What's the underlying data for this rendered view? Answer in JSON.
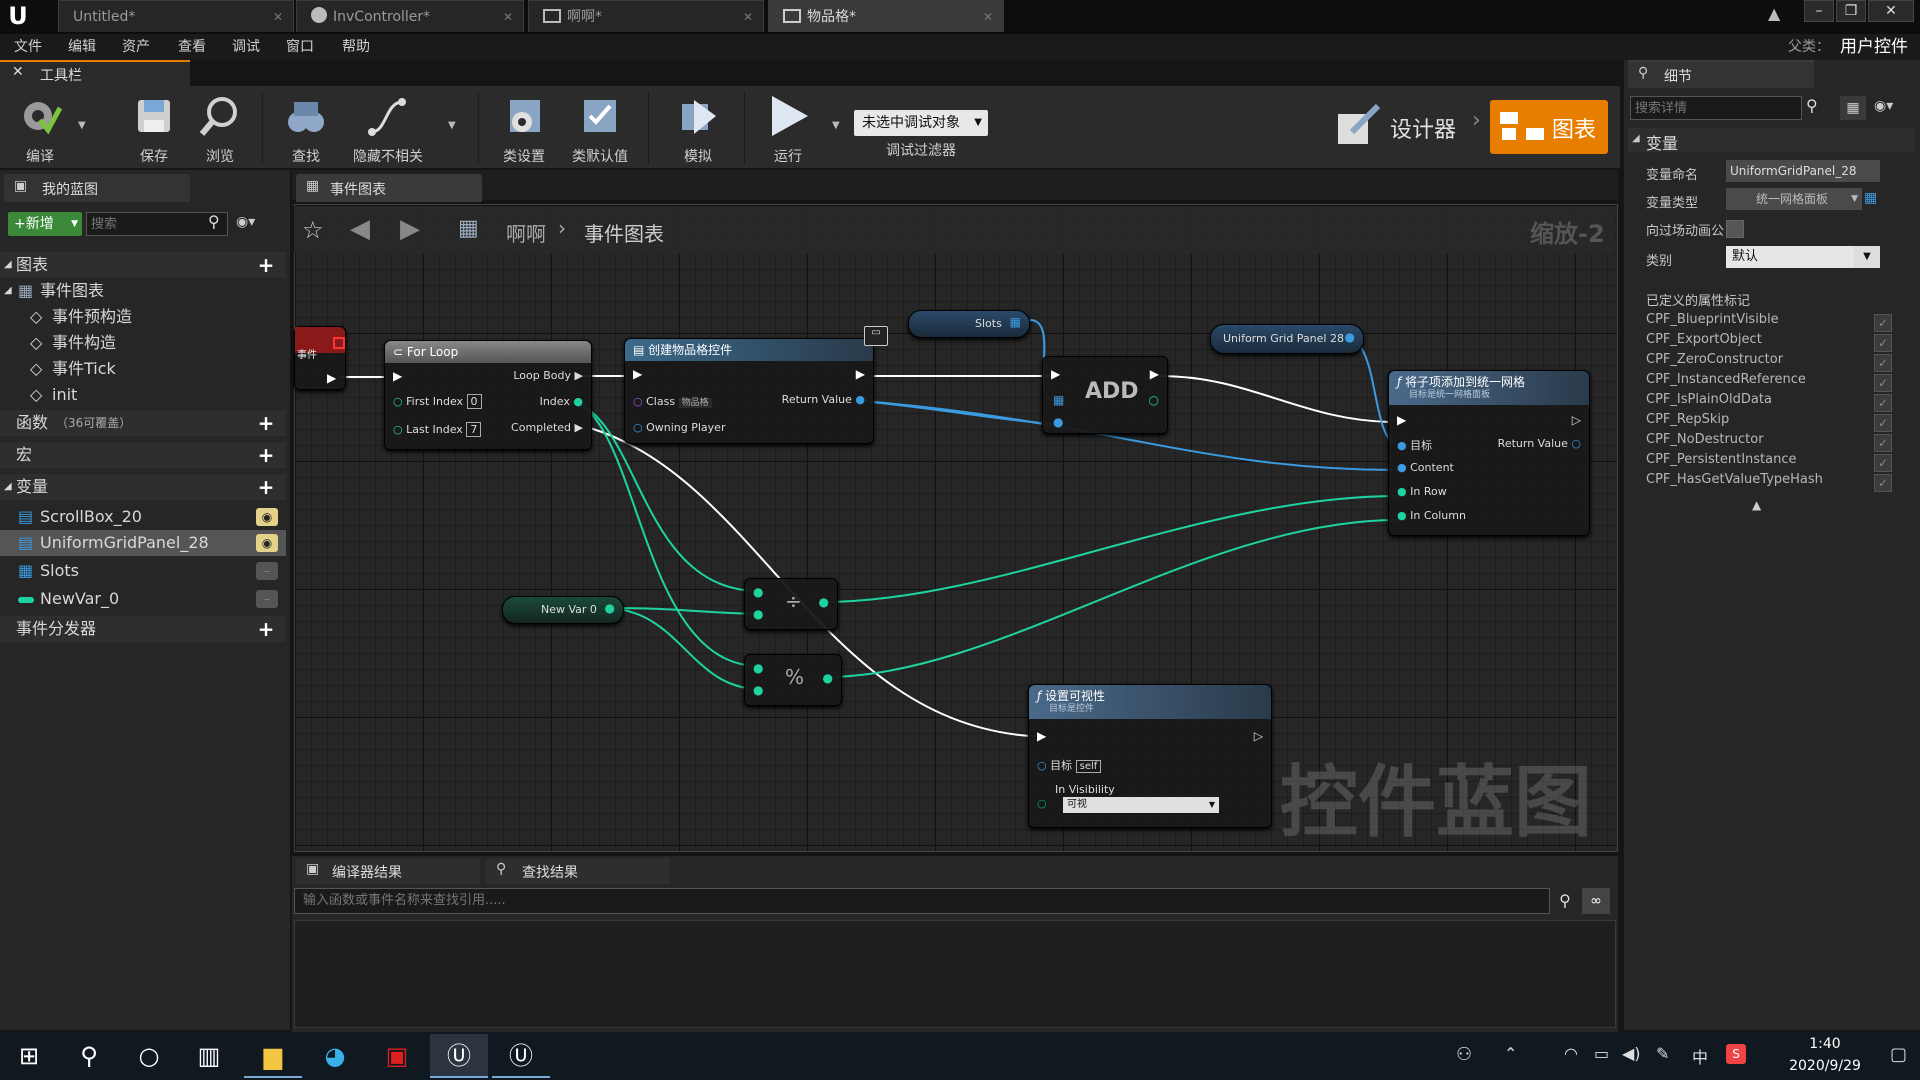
{
  "app": {
    "logo": "U",
    "brand_color": "#e87e00"
  },
  "tabs": [
    {
      "label": "Untitled*"
    },
    {
      "label": "InvController*"
    },
    {
      "label": "啊啊*"
    },
    {
      "label": "物品格*"
    }
  ],
  "parent": {
    "label": "父类：",
    "value": "用户控件"
  },
  "menu": [
    "文件",
    "编辑",
    "资产",
    "查看",
    "调试",
    "窗口",
    "帮助"
  ],
  "toolbar": {
    "tab_label": "工具栏",
    "buttons": [
      "编译",
      "保存",
      "浏览",
      "查找",
      "隐藏不相关",
      "类设置",
      "类默认值",
      "模拟",
      "运行"
    ],
    "debug_select": "未选中调试对象",
    "debug_filter": "调试过滤器",
    "designer": "设计器",
    "graph": "图表"
  },
  "my_blueprint": {
    "tab": "我的蓝图",
    "add_button": "+新增",
    "search_placeholder": "搜索",
    "sections": {
      "graphs": "图表",
      "event_graph": "事件图表",
      "events": [
        "事件预构造",
        "事件构造",
        "事件Tick",
        "init"
      ],
      "functions": "函数",
      "functions_note": "（36可覆盖）",
      "macros": "宏",
      "variables": "变量",
      "vars": [
        "ScrollBox_20",
        "UniformGridPanel_28",
        "Slots",
        "NewVar_0"
      ],
      "dispatchers": "事件分发器"
    }
  },
  "graph": {
    "tab": "事件图表",
    "breadcrumb_root": "啊啊",
    "breadcrumb_leaf": "事件图表",
    "zoom": "缩放-2",
    "watermark": "控件蓝图",
    "nodes": {
      "event_stub": "事件",
      "for_loop": {
        "title": "For Loop",
        "loop_body": "Loop Body",
        "first_index": "First Index",
        "first_index_val": "0",
        "index": "Index",
        "last_index": "Last Index",
        "last_index_val": "7",
        "completed": "Completed"
      },
      "create_widget": {
        "title": "创建物品格控件",
        "class": "Class",
        "class_val": "物品格",
        "return_value": "Return Value",
        "owning_player": "Owning Player"
      },
      "slots": "Slots",
      "add": "ADD",
      "ugp": "Uniform Grid Panel 28",
      "add_child": {
        "title": "将子项添加到统一网格",
        "subtitle": "目标是统一网格面板",
        "target": "目标",
        "return_value": "Return Value",
        "content": "Content",
        "in_row": "In Row",
        "in_column": "In Column"
      },
      "new_var": "New Var 0",
      "divide": "÷",
      "modulo": "%",
      "set_vis": {
        "title": "设置可视性",
        "subtitle": "目标是控件",
        "target": "目标",
        "self": "self",
        "in_visibility": "In Visibility",
        "vis_val": "可视"
      }
    }
  },
  "bottom": {
    "tab_compiler": "编译器结果",
    "tab_find": "查找结果",
    "find_placeholder": "输入函数或事件名称来查找引用....."
  },
  "details": {
    "tab": "细节",
    "search_placeholder": "搜索详情",
    "section_var": "变量",
    "var_name_label": "变量命名",
    "var_name": "UniformGridPanel_28",
    "var_type_label": "变量类型",
    "var_type": "统一网格面板",
    "expose_label": "向过场动画公",
    "category_label": "类别",
    "category": "默认",
    "flags_title": "已定义的属性标记",
    "flags": [
      "CPF_BlueprintVisible",
      "CPF_ExportObject",
      "CPF_ZeroConstructor",
      "CPF_InstancedReference",
      "CPF_IsPlainOldData",
      "CPF_RepSkip",
      "CPF_NoDestructor",
      "CPF_PersistentInstance",
      "CPF_HasGetValueTypeHash"
    ]
  },
  "taskbar": {
    "time": "1:40",
    "date": "2020/9/29",
    "ime": "中"
  }
}
